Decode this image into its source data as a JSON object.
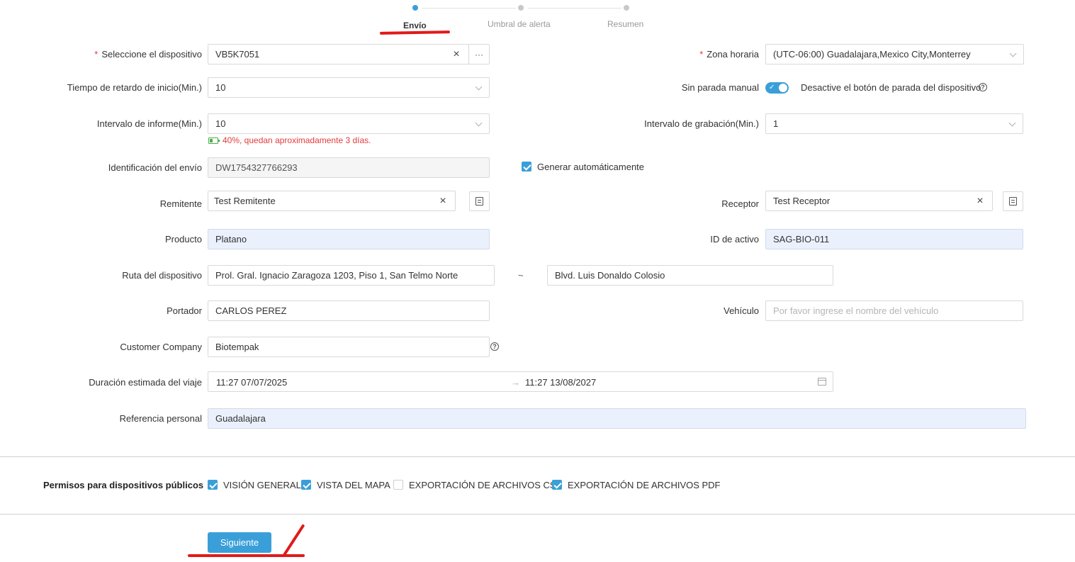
{
  "steps": [
    {
      "label": "Envío",
      "active": true
    },
    {
      "label": "Umbral de alerta",
      "active": false
    },
    {
      "label": "Resumen",
      "active": false
    }
  ],
  "form": {
    "device": {
      "label": "Seleccione el dispositivo",
      "value": "VB5K7051",
      "more": "···"
    },
    "timezone": {
      "label": "Zona horaria",
      "value": "(UTC-06:00) Guadalajara,Mexico City,Monterrey"
    },
    "start_delay": {
      "label": "Tiempo de retardo de inicio(Min.)",
      "value": "10"
    },
    "manual_stop": {
      "label": "Sin parada manual",
      "description": "Desactive el botón de parada del dispositivo",
      "enabled": true
    },
    "report_interval": {
      "label": "Intervalo de informe(Min.)",
      "value": "10"
    },
    "battery_note": "40%, quedan aproximadamente 3 días.",
    "battery_level": 0.4,
    "record_interval": {
      "label": "Intervalo de grabación(Min.)",
      "value": "1"
    },
    "shipment_id": {
      "label": "Identificación del envío",
      "value": "DW1754327766293"
    },
    "auto_generate": {
      "label": "Generar automáticamente",
      "checked": true
    },
    "sender": {
      "label": "Remitente",
      "value": "Test Remitente"
    },
    "receiver": {
      "label": "Receptor",
      "value": "Test Receptor"
    },
    "product": {
      "label": "Producto",
      "value": "Platano"
    },
    "asset_id": {
      "label": "ID de activo",
      "value": "SAG-BIO-011"
    },
    "route": {
      "label": "Ruta del dispositivo",
      "from": "Prol. Gral. Ignacio Zaragoza 1203, Piso 1, San Telmo Norte",
      "separator": "~",
      "to": "Blvd. Luis Donaldo Colosio"
    },
    "carrier": {
      "label": "Portador",
      "value": "CARLOS PEREZ"
    },
    "vehicle": {
      "label": "Vehículo",
      "placeholder": "Por favor ingrese el nombre del vehículo"
    },
    "customer_company": {
      "label": "Customer Company",
      "value": "Biotempak"
    },
    "trip_duration": {
      "label": "Duración estimada del viaje",
      "start": "11:27 07/07/2025",
      "arrow": "→",
      "end": "11:27 13/08/2027"
    },
    "personal_ref": {
      "label": "Referencia personal",
      "value": "Guadalajara"
    }
  },
  "permissions": {
    "label": "Permisos para dispositivos públicos",
    "items": [
      {
        "label": "VISIÓN GENERAL",
        "checked": true
      },
      {
        "label": "VISTA DEL MAPA",
        "checked": true
      },
      {
        "label": "EXPORTACIÓN DE ARCHIVOS CSV",
        "checked": false
      },
      {
        "label": "EXPORTACIÓN DE ARCHIVOS PDF",
        "checked": true
      }
    ]
  },
  "actions": {
    "next": "Siguiente"
  },
  "colors": {
    "accent": "#3a9fd8",
    "required": "#e23b3b",
    "annotation": "#e11a1a",
    "battery": "#4ab04a"
  }
}
